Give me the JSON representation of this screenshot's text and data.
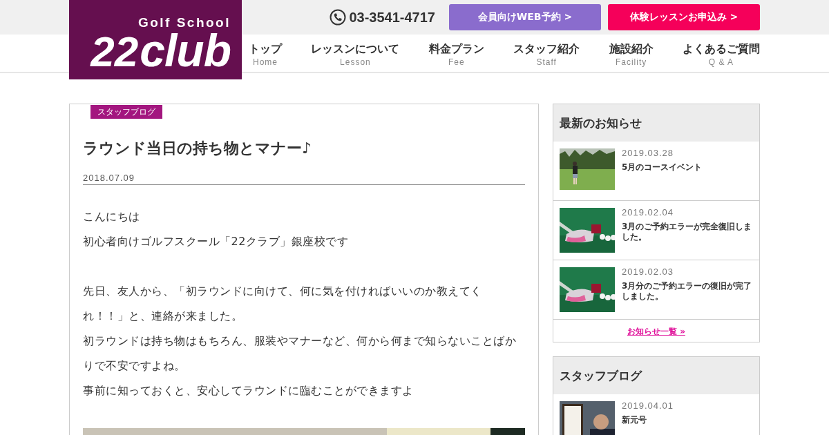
{
  "logo": {
    "tagline": "Golf School",
    "mark": "22",
    "name": "club"
  },
  "header": {
    "phone": "03-3541-4717",
    "buttons": [
      {
        "label": "会員向けWEB予約 >",
        "kind": "member"
      },
      {
        "label": "体験レッスンお申込み >",
        "kind": "trial"
      }
    ]
  },
  "nav": [
    {
      "label": "トップ",
      "sub": "Home"
    },
    {
      "label": "レッスンについて",
      "sub": "Lesson"
    },
    {
      "label": "料金プラン",
      "sub": "Fee"
    },
    {
      "label": "スタッフ紹介",
      "sub": "Staff"
    },
    {
      "label": "施設紹介",
      "sub": "Facility"
    },
    {
      "label": "よくあるご質問",
      "sub": "Q & A"
    }
  ],
  "article": {
    "category": "スタッフブログ",
    "title": "ラウンド当日の持ち物とマナー♪",
    "date": "2018.07.09",
    "paragraphs": [
      [
        "こんにちは",
        "初心者向けゴルフスクール「22クラブ」銀座校です"
      ],
      [
        "先日、友人から、「初ラウンドに向けて、何に気を付ければいいのか教えてくれ！！」と、連絡が来ました。",
        "初ラウンドは持ち物はもちろん、服装やマナーなど、何から何まで知らないことばかりで不安ですよね。",
        "事前に知っておくと、安心してラウンドに臨むことができますよ"
      ]
    ],
    "image": {
      "kind": "picture"
    }
  },
  "sidebar": [
    {
      "title": "最新のお知らせ",
      "items": [
        {
          "date": "2019.03.28",
          "title": "5月のコースイベント",
          "thumb": {
            "kind": "picture"
          }
        },
        {
          "date": "2019.02.04",
          "title": "3月のご予約エラーが完全復旧しました。",
          "thumb": {
            "kind": "picture"
          }
        },
        {
          "date": "2019.02.03",
          "title": "3月分のご予約エラーの復旧が完了しました。",
          "thumb": {
            "kind": "picture"
          }
        }
      ],
      "more": "お知らせ一覧 »"
    },
    {
      "title": "スタッフブログ",
      "items": [
        {
          "date": "2019.04.01",
          "title": "新元号",
          "thumb": {
            "kind": "picture"
          }
        }
      ]
    }
  ]
}
